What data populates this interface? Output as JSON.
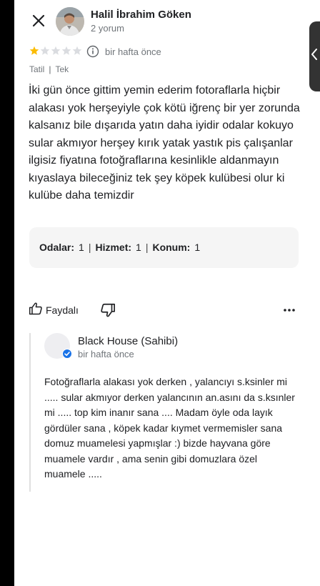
{
  "review": {
    "author_name": "Halil İbrahim Göken",
    "author_sub": "2 yorum",
    "rating": 1,
    "rating_max": 5,
    "time": "bir hafta önce",
    "tags": [
      "Tatil",
      "Tek"
    ],
    "text": "İki gün önce gittim yemin ederim fotoraflarla hiçbir alakası yok herşeyiyle çok kötü iğrenç bir yer zorunda kalsanız bile dışarıda yatın daha iyidir odalar kokuyo sular akmıyor herşey kırık yatak yastık pis çalışanlar ilgisiz fiyatına fotoğraflarına kesinlikle aldanmayın kıyaslaya bileceğiniz tek şey köpek kulübesi olur ki kulübe daha temizdir",
    "scores": [
      {
        "label": "Odalar:",
        "value": "1"
      },
      {
        "label": "Hizmet:",
        "value": "1"
      },
      {
        "label": "Konum:",
        "value": "1"
      }
    ],
    "helpful_label": "Faydalı"
  },
  "owner_reply": {
    "name": "Black House (Sahibi)",
    "time": "bir hafta önce",
    "text": "Fotoğraflarla alakası yok derken , yalancıyı s.ksinler mi ..... sular akmıyor derken yalancının an.asını da s.ksınler mi ..... top kim inanır sana .... Madam öyle oda layık gördüler sana , köpek kadar kıymet vermemisler sana domuz muamelesi yapmışlar :) bizde hayvana göre muamele vardır , ama senin gibi domuzlara özel muamele ....."
  },
  "colors": {
    "star_filled": "#fbbc04",
    "star_empty": "#dadce0",
    "verified_badge": "#1a73e8",
    "secondary_text": "#70757a"
  }
}
